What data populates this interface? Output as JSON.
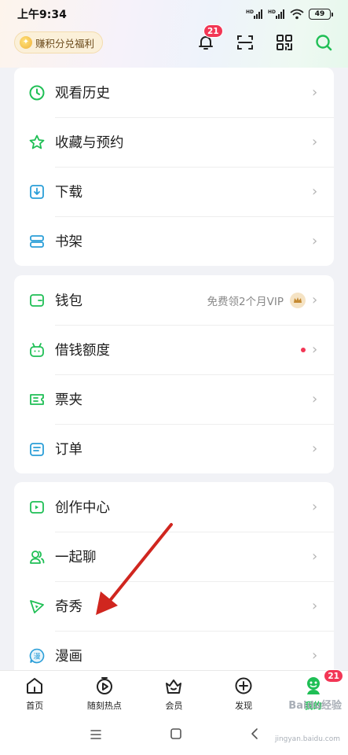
{
  "status_bar": {
    "time": "上午9:34",
    "battery": "49"
  },
  "header": {
    "points_label": "赚积分兑福利",
    "notification_count": "21",
    "icons": [
      "bell-icon",
      "scan-icon",
      "qr-code-icon",
      "search-icon"
    ]
  },
  "sections": [
    {
      "items": [
        {
          "label": "观看历史",
          "icon": "clock-icon"
        },
        {
          "label": "收藏与预约",
          "icon": "star-icon"
        },
        {
          "label": "下载",
          "icon": "download-icon"
        },
        {
          "label": "书架",
          "icon": "bookshelf-icon"
        }
      ]
    },
    {
      "items": [
        {
          "label": "钱包",
          "icon": "wallet-icon",
          "hint": "免费领2个月VIP"
        },
        {
          "label": "借钱额度",
          "icon": "loan-icon"
        },
        {
          "label": "票夹",
          "icon": "ticket-icon"
        },
        {
          "label": "订单",
          "icon": "order-icon"
        }
      ]
    },
    {
      "items": [
        {
          "label": "创作中心",
          "icon": "creator-icon"
        },
        {
          "label": "一起聊",
          "icon": "chat-icon"
        },
        {
          "label": "奇秀",
          "icon": "qixiu-icon"
        },
        {
          "label": "漫画",
          "icon": "comic-icon",
          "icon_text": "漫"
        }
      ]
    }
  ],
  "tabs": [
    {
      "label": "首页",
      "icon": "home-icon"
    },
    {
      "label": "随刻热点",
      "icon": "hot-icon"
    },
    {
      "label": "会员",
      "icon": "vip-icon"
    },
    {
      "label": "发现",
      "icon": "discover-icon"
    },
    {
      "label": "我的",
      "icon": "profile-icon",
      "active": true,
      "badge": "21"
    }
  ],
  "watermark": {
    "text": "Baidu经验",
    "url_text": "jingyan.baidu.com"
  },
  "colors": {
    "accent": "#1fbf55",
    "badge": "#f23655",
    "annotation_arrow": "#d0261f"
  }
}
